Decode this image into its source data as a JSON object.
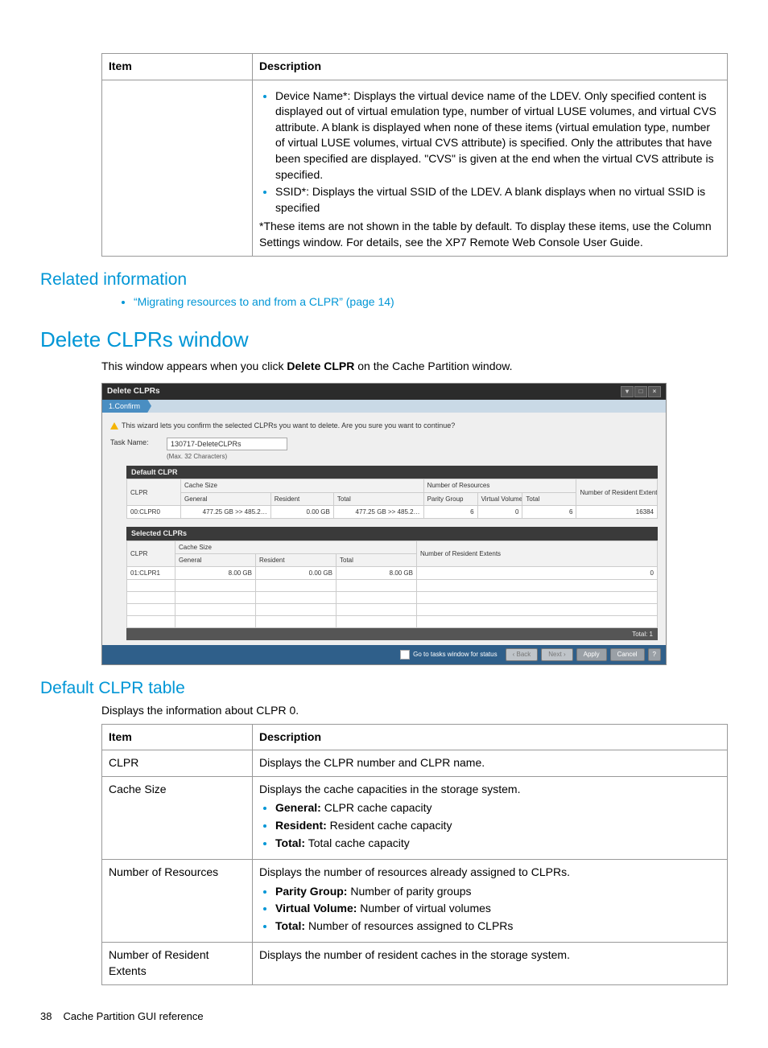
{
  "top_table": {
    "header_item": "Item",
    "header_desc": "Description",
    "bullets": [
      "Device Name*: Displays the virtual device name of the LDEV. Only specified content is displayed out of virtual emulation type, number of virtual LUSE volumes, and virtual CVS attribute. A blank is displayed when none of these items (virtual emulation type, number of virtual LUSE volumes, virtual CVS attribute) is specified. Only the attributes that have been specified are displayed. \"CVS\" is given at the end when the virtual CVS attribute is specified.",
      "SSID*: Displays the virtual SSID of the LDEV. A blank displays when no virtual SSID is specified"
    ],
    "note": "*These items are not shown in the table by default. To display these items, use the Column Settings window. For details, see the XP7 Remote Web Console User Guide."
  },
  "related": {
    "heading": "Related information",
    "link_text": "“Migrating resources to and from a CLPR” (page 14)"
  },
  "delete_section": {
    "heading": "Delete CLPRs window",
    "intro_pre": "This window appears when you click ",
    "intro_bold": "Delete CLPR",
    "intro_post": " on the Cache Partition window."
  },
  "screenshot": {
    "title": "Delete CLPRs",
    "step_tab": "1.Confirm",
    "warning": "This wizard lets you confirm the selected CLPRs you want to delete. Are you sure you want to continue?",
    "task_label": "Task Name:",
    "task_value": "130717-DeleteCLPRs",
    "task_note": "(Max. 32 Characters)",
    "default_section": "Default CLPR",
    "selected_section": "Selected CLPRs",
    "hdr": {
      "clpr": "CLPR",
      "cache_size": "Cache Size",
      "general": "General",
      "resident": "Resident",
      "total": "Total",
      "num_res": "Number of Resources",
      "parity": "Parity Group",
      "vv": "Virtual Volume",
      "nre": "Number of Resident Extents"
    },
    "default_row": {
      "clpr": "00:CLPR0",
      "general": "477.25 GB >> 485.2…",
      "resident": "0.00 GB",
      "total": "477.25 GB >> 485.2…",
      "parity": "6",
      "vv": "0",
      "rtotal": "6",
      "nre": "16384"
    },
    "selected_row": {
      "clpr": "01:CLPR1",
      "general": "8.00 GB",
      "resident": "0.00 GB",
      "total": "8.00 GB",
      "nre": "0"
    },
    "total_bar": "Total: 1",
    "footer_check_label": "Go to tasks window for status",
    "btn_back": "‹ Back",
    "btn_next": "Next ›",
    "btn_apply": "Apply",
    "btn_cancel": "Cancel",
    "btn_help": "?"
  },
  "default_table_section": {
    "heading": "Default CLPR table",
    "intro": "Displays the information about CLPR 0.",
    "header_item": "Item",
    "header_desc": "Description",
    "rows": [
      {
        "item": "CLPR",
        "desc_plain": "Displays the CLPR number and CLPR name."
      },
      {
        "item": "Cache Size",
        "desc_lead": "Displays the cache capacities in the storage system.",
        "bullets": [
          {
            "b": "General:",
            "t": " CLPR cache capacity"
          },
          {
            "b": "Resident:",
            "t": " Resident cache capacity"
          },
          {
            "b": "Total:",
            "t": " Total cache capacity"
          }
        ]
      },
      {
        "item": "Number of Resources",
        "desc_lead": "Displays the number of resources already assigned to CLPRs.",
        "bullets": [
          {
            "b": "Parity Group:",
            "t": " Number of parity groups"
          },
          {
            "b": "Virtual Volume:",
            "t": " Number of virtual volumes"
          },
          {
            "b": "Total:",
            "t": " Number of resources assigned to CLPRs"
          }
        ]
      },
      {
        "item": "Number of Resident Extents",
        "desc_plain": "Displays the number of resident caches in the storage system."
      }
    ]
  },
  "footer": {
    "page": "38",
    "text": "Cache Partition GUI reference"
  }
}
